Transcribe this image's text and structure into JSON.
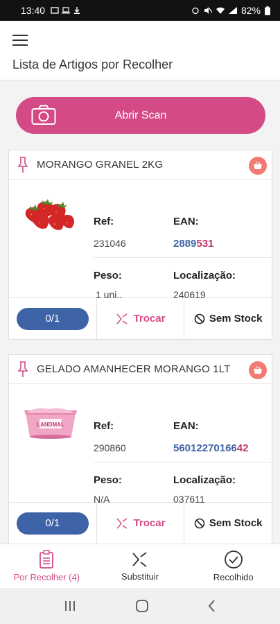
{
  "status_bar": {
    "time": "13:40",
    "battery": "82%"
  },
  "app_bar": {
    "title": "Lista de Artigos por Recolher"
  },
  "scan": {
    "label": "Abrir Scan"
  },
  "labels": {
    "ref": "Ref:",
    "ean": "EAN:",
    "peso": "Peso:",
    "localizacao": "Localização:"
  },
  "items": [
    {
      "name": "MORANGO GRANEL 2KG",
      "ref": "231046",
      "ean_prefix": "2889",
      "ean_suffix": "531",
      "peso": "1 uni..",
      "localizacao": "240619",
      "counter": "0/1",
      "trocar": "Trocar",
      "sem_stock": "Sem Stock"
    },
    {
      "name": "GELADO AMANHECER MORANGO 1LT",
      "ref": "290860",
      "ean_prefix": "56012270166",
      "ean_suffix": "42",
      "peso": "N/A",
      "localizacao": "037611",
      "counter": "0/1",
      "trocar": "Trocar",
      "sem_stock": "Sem Stock",
      "package_text": "LANDMAL"
    }
  ],
  "bottom_nav": [
    {
      "label": "Por Recolher (4)",
      "icon": "clipboard-icon",
      "active": true
    },
    {
      "label": "Substituir",
      "icon": "swap-icon",
      "active": false
    },
    {
      "label": "Recolhido",
      "icon": "check-circle-icon",
      "active": false
    }
  ],
  "colors": {
    "accent": "#d44a86",
    "blue": "#3e63a6",
    "basket": "#f27a72"
  }
}
